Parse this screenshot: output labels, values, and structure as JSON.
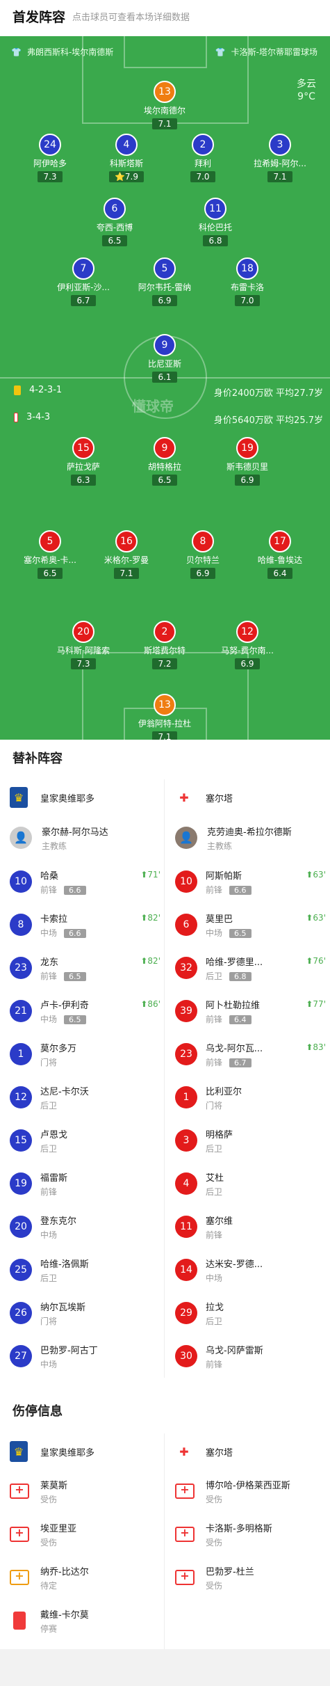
{
  "header": {
    "title": "首发阵容",
    "subtitle": "点击球员可查看本场详细数据"
  },
  "pitch": {
    "home_team": "弗朗西斯科-埃尔南德斯",
    "away_team": "卡洛斯-塔尔蒂耶雷球场",
    "weather": "多云",
    "temp": "9°C",
    "watermark": "懂球帝",
    "home_form": "4-2-3-1",
    "home_value": "身价2400万欧 平均27.7岁",
    "away_form": "3-4-3",
    "away_value": "身价5640万欧 平均25.7岁"
  },
  "home_players": [
    {
      "num": "13",
      "name": "埃尔南德尔",
      "rating": "7.1",
      "kind": "o"
    },
    {
      "num": "24",
      "name": "阿伊哈多",
      "rating": "7.3",
      "kind": "b",
      "yellow": true
    },
    {
      "num": "4",
      "name": "科斯塔斯",
      "rating": "7.9",
      "kind": "b",
      "captain": "C",
      "star": "⭐"
    },
    {
      "num": "2",
      "name": "拜利",
      "rating": "7.0",
      "kind": "b"
    },
    {
      "num": "3",
      "name": "拉希姆-阿尔...",
      "rating": "7.1",
      "kind": "b"
    },
    {
      "num": "6",
      "name": "夸西-西博",
      "rating": "6.5",
      "kind": "b"
    },
    {
      "num": "11",
      "name": "科伦巴托",
      "rating": "6.8",
      "kind": "b",
      "yellow": true
    },
    {
      "num": "7",
      "name": "伊利亚斯-沙...",
      "rating": "6.7",
      "kind": "b",
      "sub": "82'"
    },
    {
      "num": "5",
      "name": "阿尔韦托-雷纳",
      "rating": "6.9",
      "kind": "b",
      "sub": "82'"
    },
    {
      "num": "18",
      "name": "布雷卡洛",
      "rating": "7.0",
      "kind": "b",
      "sub": "71'"
    },
    {
      "num": "9",
      "name": "比尼亚斯",
      "rating": "6.1",
      "kind": "b",
      "sub": "86'"
    }
  ],
  "away_players": [
    {
      "num": "15",
      "name": "萨拉戈萨",
      "rating": "6.3",
      "kind": "r",
      "sub": "63'"
    },
    {
      "num": "9",
      "name": "胡特格拉",
      "rating": "6.5",
      "kind": "r",
      "sub": "83'"
    },
    {
      "num": "19",
      "name": "斯韦德贝里",
      "rating": "6.9",
      "kind": "r",
      "sub": "77'",
      "yellow": true
    },
    {
      "num": "5",
      "name": "塞尔希奥-卡...",
      "rating": "6.5",
      "kind": "r"
    },
    {
      "num": "16",
      "name": "米格尔-罗曼",
      "rating": "7.1",
      "kind": "r"
    },
    {
      "num": "8",
      "name": "贝尔特兰",
      "rating": "6.9",
      "kind": "r",
      "sub": "63'",
      "captain": "C"
    },
    {
      "num": "17",
      "name": "哈维-鲁埃达",
      "rating": "6.4",
      "kind": "r"
    },
    {
      "num": "20",
      "name": "马科斯-阿隆索",
      "rating": "7.3",
      "kind": "r"
    },
    {
      "num": "2",
      "name": "斯塔费尔特",
      "rating": "7.2",
      "kind": "r"
    },
    {
      "num": "12",
      "name": "马努-费尔南...",
      "rating": "6.9",
      "kind": "r",
      "sub": "76'",
      "yellow": true
    },
    {
      "num": "13",
      "name": "伊翁阿特-拉杜",
      "rating": "7.1",
      "kind": "o"
    }
  ],
  "subs": {
    "title": "替补阵容",
    "home_club": "皇家奥维耶多",
    "away_club": "塞尔塔",
    "home_coach": "豪尔赫-阿尔马达",
    "away_coach": "克劳迪奥-希拉尔德斯",
    "coach_role": "主教练",
    "home": [
      {
        "num": "10",
        "name": "哈桑",
        "pos": "前锋",
        "rating": "6.6",
        "min": "71'"
      },
      {
        "num": "8",
        "name": "卡索拉",
        "pos": "中场",
        "rating": "6.6",
        "min": "82'"
      },
      {
        "num": "23",
        "name": "龙东",
        "pos": "前锋",
        "rating": "6.5",
        "min": "82'"
      },
      {
        "num": "21",
        "name": "卢卡-伊利奇",
        "pos": "中场",
        "rating": "6.5",
        "min": "86'"
      },
      {
        "num": "1",
        "name": "莫尔多万",
        "pos": "门将"
      },
      {
        "num": "12",
        "name": "达尼-卡尔沃",
        "pos": "后卫"
      },
      {
        "num": "15",
        "name": "卢恩戈",
        "pos": "后卫"
      },
      {
        "num": "19",
        "name": "福雷斯",
        "pos": "前锋"
      },
      {
        "num": "20",
        "name": "登东克尔",
        "pos": "中场"
      },
      {
        "num": "25",
        "name": "哈维-洛佩斯",
        "pos": "后卫"
      },
      {
        "num": "26",
        "name": "纳尔瓦埃斯",
        "pos": "门将"
      },
      {
        "num": "27",
        "name": "巴勃罗-阿古丁",
        "pos": "中场"
      }
    ],
    "away": [
      {
        "num": "10",
        "name": "阿斯帕斯",
        "pos": "前锋",
        "rating": "6.6",
        "min": "63'"
      },
      {
        "num": "6",
        "name": "莫里巴",
        "pos": "中场",
        "rating": "6.5",
        "min": "63'"
      },
      {
        "num": "32",
        "name": "哈维-罗德里...",
        "pos": "后卫",
        "rating": "6.8",
        "min": "76'"
      },
      {
        "num": "39",
        "name": "阿卜杜勒拉维",
        "pos": "前锋",
        "rating": "6.4",
        "min": "77'"
      },
      {
        "num": "23",
        "name": "乌戈-阿尔瓦...",
        "pos": "前锋",
        "rating": "6.7",
        "min": "83'"
      },
      {
        "num": "1",
        "name": "比利亚尔",
        "pos": "门将"
      },
      {
        "num": "3",
        "name": "明格萨",
        "pos": "后卫"
      },
      {
        "num": "4",
        "name": "艾杜",
        "pos": "后卫"
      },
      {
        "num": "11",
        "name": "塞尔维",
        "pos": "前锋"
      },
      {
        "num": "14",
        "name": "达米安-罗德...",
        "pos": "中场"
      },
      {
        "num": "29",
        "name": "拉戈",
        "pos": "后卫"
      },
      {
        "num": "30",
        "name": "乌戈-冈萨雷斯",
        "pos": "前锋"
      }
    ]
  },
  "injuries": {
    "title": "伤停信息",
    "home": [
      {
        "name": "莱莫斯",
        "status": "受伤",
        "type": "inj"
      },
      {
        "name": "埃亚里亚",
        "status": "受伤",
        "type": "inj"
      },
      {
        "name": "纳乔-比达尔",
        "status": "待定",
        "type": "doubt"
      },
      {
        "name": "戴维-卡尔莫",
        "status": "停赛",
        "type": "red"
      }
    ],
    "away": [
      {
        "name": "博尔哈-伊格莱西亚斯",
        "status": "受伤",
        "type": "inj"
      },
      {
        "name": "卡洛斯-多明格斯",
        "status": "受伤",
        "type": "inj"
      },
      {
        "name": "巴勃罗-杜兰",
        "status": "受伤",
        "type": "inj"
      }
    ]
  },
  "colors": {
    "pitch": "#3aa94c",
    "home": "#2b3bc8",
    "away": "#e31b1b",
    "keeper": "#ef7d12"
  }
}
